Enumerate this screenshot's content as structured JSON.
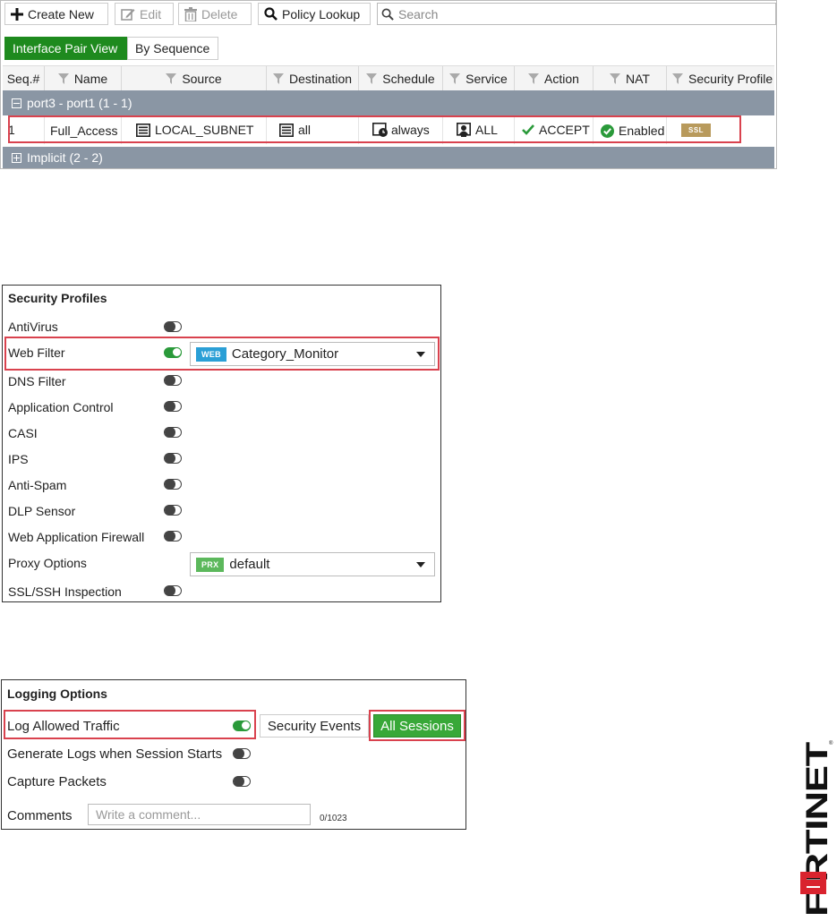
{
  "policy": {
    "toolbar": {
      "create_label": "Create New",
      "edit_label": "Edit",
      "delete_label": "Delete",
      "lookup_label": "Policy Lookup",
      "search_placeholder": "Search"
    },
    "view_tabs": [
      "Interface Pair View",
      "By Sequence"
    ],
    "columns": [
      "Seq.#",
      "Name",
      "Source",
      "Destination",
      "Schedule",
      "Service",
      "Action",
      "NAT",
      "Security Profile"
    ],
    "group1": "port3 - port1 (1 - 1)",
    "row": {
      "seq": "1",
      "name": "Full_Access",
      "source": "LOCAL_SUBNET",
      "destination": "all",
      "schedule": "always",
      "service": "ALL",
      "action": "ACCEPT",
      "nat": "Enabled",
      "profile_badge": "SSL"
    },
    "group2": "Implicit (2 - 2)"
  },
  "security_profiles": {
    "title": "Security Profiles",
    "items": [
      {
        "label": "AntiVirus",
        "enabled": false
      },
      {
        "label": "Web Filter",
        "enabled": true,
        "tag": "WEB",
        "value": "Category_Monitor"
      },
      {
        "label": "DNS Filter",
        "enabled": false
      },
      {
        "label": "Application Control",
        "enabled": false
      },
      {
        "label": "CASI",
        "enabled": false
      },
      {
        "label": "IPS",
        "enabled": false
      },
      {
        "label": "Anti-Spam",
        "enabled": false
      },
      {
        "label": "DLP Sensor",
        "enabled": false
      },
      {
        "label": "Web Application Firewall",
        "enabled": false
      },
      {
        "label": "Proxy Options",
        "tag": "PRX",
        "value": "default"
      },
      {
        "label": "SSL/SSH Inspection",
        "enabled": false
      }
    ]
  },
  "logging": {
    "title": "Logging Options",
    "log_allowed": "Log Allowed Traffic",
    "security_events": "Security Events",
    "all_sessions": "All Sessions",
    "gen_logs": "Generate Logs when Session Starts",
    "capture": "Capture Packets",
    "comments_label": "Comments",
    "comment_placeholder": "Write a comment...",
    "counter": "0/1023"
  },
  "brand": "FORTINET",
  "colors": {
    "green": "#1e8a1e",
    "group_bar": "#8a96a4",
    "highlight": "#d9424e",
    "web_tag": "#2a9fd6",
    "prx_tag": "#5cb85c",
    "ssl_tag": "#b89a5c"
  }
}
